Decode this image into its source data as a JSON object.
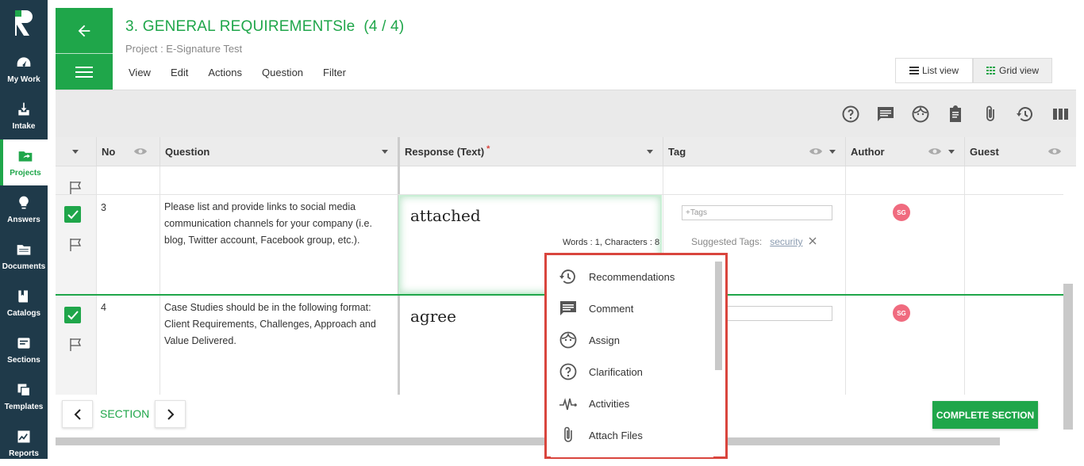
{
  "nav": [
    {
      "label": "My Work",
      "icon": "gauge-icon"
    },
    {
      "label": "Intake",
      "icon": "inbox-download-icon"
    },
    {
      "label": "Projects",
      "icon": "folder-share-icon"
    },
    {
      "label": "Answers",
      "icon": "lightbulb-icon"
    },
    {
      "label": "Documents",
      "icon": "folder-icon"
    },
    {
      "label": "Catalogs",
      "icon": "book-icon"
    },
    {
      "label": "Sections",
      "icon": "sections-icon"
    },
    {
      "label": "Templates",
      "icon": "copy-icon"
    },
    {
      "label": "Reports",
      "icon": "chart-icon"
    }
  ],
  "header": {
    "title": "3. GENERAL REQUIREMENTSle  (4 / 4)",
    "subtitle": "Project : E-Signature Test",
    "menu": [
      "View",
      "Edit",
      "Actions",
      "Question",
      "Filter"
    ],
    "list_view": "List view",
    "grid_view": "Grid view"
  },
  "columns": {
    "no": "No",
    "question": "Question",
    "response": "Response (Text)",
    "required_mark": "*",
    "tag": "Tag",
    "author": "Author",
    "guest": "Guest"
  },
  "rows": [
    {
      "no": "3",
      "question_lines": [
        "Please list and provide links to social media",
        "communication channels for your company (i.e.",
        "blog, Twitter account, Facebook group, etc.)."
      ],
      "response": "attached",
      "word_count": "Words : 1, Characters : 8",
      "tags_placeholder": "+Tags",
      "suggested_label": "Suggested Tags:",
      "suggested_tag": "security",
      "author_initials": "SG"
    },
    {
      "no": "4",
      "question_lines": [
        "Case Studies should be in the following format:",
        "Client Requirements, Challenges, Approach and",
        "Value Delivered."
      ],
      "response": "agree",
      "author_initials": "SG"
    }
  ],
  "footer": {
    "section_label": "SECTION",
    "complete_button": "COMPLETE SECTION"
  },
  "popup": {
    "items": [
      {
        "label": "Recommendations",
        "icon": "history-icon"
      },
      {
        "label": "Comment",
        "icon": "comment-icon"
      },
      {
        "label": "Assign",
        "icon": "face-icon"
      },
      {
        "label": "Clarification",
        "icon": "help-circle-icon"
      },
      {
        "label": "Activities",
        "icon": "pulse-icon"
      },
      {
        "label": "Attach Files",
        "icon": "paperclip-icon"
      }
    ]
  },
  "colors": {
    "brand_green": "#1fa64a",
    "nav_bg": "#1f3a4a",
    "popup_border": "#d9453d",
    "avatar": "#f06b7f"
  }
}
